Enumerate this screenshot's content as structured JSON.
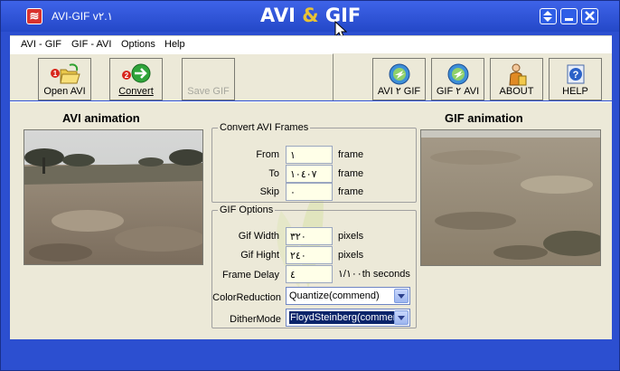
{
  "window": {
    "title": "AVI-GIF v۲.۱",
    "brand_left": "AVI",
    "brand_amp": "&",
    "brand_right": "GIF",
    "controls": [
      "help-arrows",
      "minimize",
      "close"
    ]
  },
  "menu": [
    "AVI - GIF",
    "GIF - AVI",
    "Options",
    "Help"
  ],
  "toolbar": {
    "left": [
      {
        "label": "Open AVI",
        "badge": "1",
        "icon": "open-folder-icon",
        "enabled": true
      },
      {
        "label": "Convert",
        "badge": "2",
        "icon": "green-arrow-icon",
        "enabled": true
      },
      {
        "label": "Save GIF",
        "icon": "",
        "enabled": false
      }
    ],
    "right": [
      {
        "label": "AVI ۲ GIF",
        "icon": "avi-to-gif-icon"
      },
      {
        "label": "GIF ۲ AVI",
        "icon": "gif-to-avi-icon"
      },
      {
        "label": "ABOUT",
        "icon": "person-icon"
      },
      {
        "label": "HELP",
        "icon": "help-icon"
      }
    ]
  },
  "avi_caption": "AVI  animation",
  "gif_caption": "GIF  animation",
  "convert_frames": {
    "legend": "Convert AVI Frames",
    "rows": [
      {
        "label": "From",
        "value": "۱",
        "unit": "frame"
      },
      {
        "label": "To",
        "value": "۱۰٤۰۷",
        "unit": "frame"
      },
      {
        "label": "Skip",
        "value": "۰",
        "unit": "frame"
      }
    ]
  },
  "gif_options": {
    "legend": "GIF Options",
    "rows": [
      {
        "label": "Gif Width",
        "value": "۳۲۰",
        "unit": "pixels"
      },
      {
        "label": "Gif Hight",
        "value": "۲٤۰",
        "unit": "pixels"
      },
      {
        "label": "Frame Delay",
        "value": "٤",
        "unit": "۱/۱۰۰th seconds"
      }
    ],
    "color_reduction": {
      "label": "ColorReduction",
      "value": "Quantize(commend)"
    },
    "dither_mode": {
      "label": "DitherMode",
      "value": "FloydSteinberg(commend)"
    }
  },
  "colors": {
    "title_bar": "#2c4fd0",
    "panel": "#ece9d8",
    "accent_gold": "#e8c235"
  }
}
